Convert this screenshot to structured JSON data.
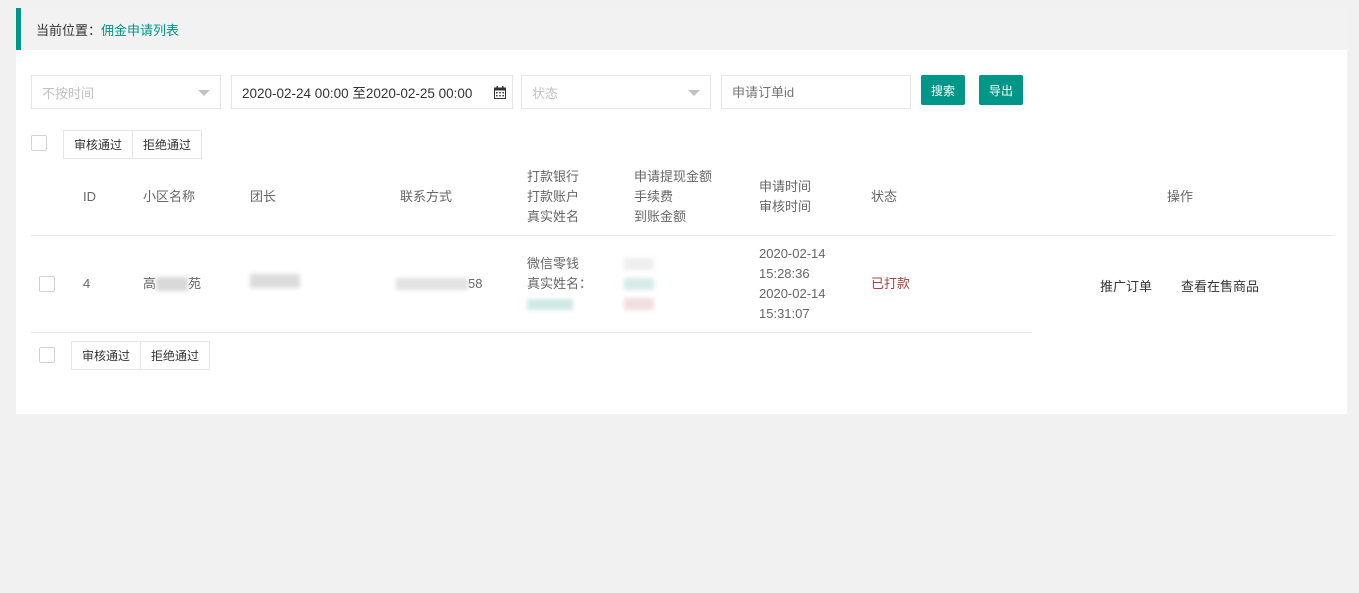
{
  "breadcrumb": {
    "prefix": "当前位置：",
    "current": "佣金申请列表"
  },
  "filters": {
    "time_type": {
      "placeholder": "不按时间"
    },
    "date_range": {
      "value": "2020-02-24 00:00 至2020-02-25 00:00"
    },
    "status": {
      "placeholder": "状态"
    },
    "order_id": {
      "placeholder": "申请订单id"
    },
    "search_label": "搜索",
    "export_label": "导出"
  },
  "bulk_actions": {
    "approve_label": "审核通过",
    "reject_label": "拒绝通过"
  },
  "table": {
    "headers": {
      "id": "ID",
      "community": "小区名称",
      "leader": "团长",
      "contact": "联系方式",
      "bank_line1": "打款银行",
      "bank_line2": "打款账户",
      "bank_line3": "真实姓名",
      "amount_line1": "申请提现金额",
      "amount_line2": "手续费",
      "amount_line3": "到账金额",
      "time_line1": "申请时间",
      "time_line2": "审核时间",
      "status": "状态",
      "actions": "操作"
    },
    "rows": [
      {
        "id": "4",
        "community_start": "高",
        "community_end": "苑",
        "contact_end": "58",
        "bank": "微信零钱",
        "real_name_label": "真实姓名：",
        "apply_date": "2020-02-14",
        "apply_time": "15:28:36",
        "audit_date": "2020-02-14",
        "audit_time": "15:31:07",
        "status": "已打款",
        "action_orders": "推广订单",
        "action_goods": "查看在售商品"
      }
    ]
  },
  "colors": {
    "accent": "#009688",
    "status_paid": "#a94442"
  }
}
